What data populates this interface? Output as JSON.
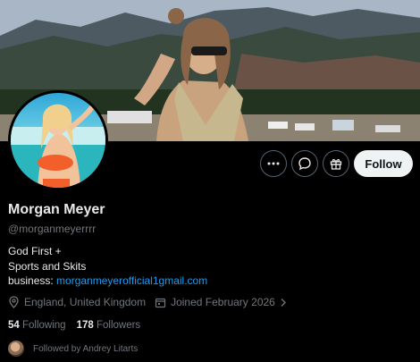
{
  "profile": {
    "name": "Morgan Meyer",
    "handle": "@morganmeyerrrr",
    "bio_line1": "God First +",
    "bio_line2": "Sports and Skits",
    "bio_business_label": "business:",
    "bio_business_email": "morganmeyerofficial1gmail.com",
    "location": "England, United Kingdom",
    "joined": "Joined February 2026",
    "following_count": "54",
    "following_label": "Following",
    "followers_count": "178",
    "followers_label": "Followers",
    "followed_by": "Followed by Andrey Litarts"
  },
  "actions": {
    "more_icon": "more-dots-icon",
    "message_icon": "message-icon",
    "subscribe_icon": "gift-icon",
    "follow_label": "Follow"
  },
  "colors": {
    "background": "#000000",
    "link": "#1d9bf0",
    "muted": "#71767b",
    "follow_bg": "#eff3f4"
  }
}
